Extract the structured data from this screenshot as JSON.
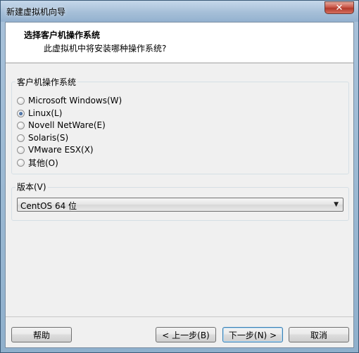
{
  "window": {
    "title": "新建虚拟机向导",
    "close_glyph": "✕"
  },
  "header": {
    "title": "选择客户机操作系统",
    "subtitle": "此虚拟机中将安装哪种操作系统?"
  },
  "os_group": {
    "label": "客户机操作系统",
    "options": [
      {
        "label": "Microsoft Windows(W)",
        "checked": false
      },
      {
        "label": "Linux(L)",
        "checked": true
      },
      {
        "label": "Novell NetWare(E)",
        "checked": false
      },
      {
        "label": "Solaris(S)",
        "checked": false
      },
      {
        "label": "VMware ESX(X)",
        "checked": false
      },
      {
        "label": "其他(O)",
        "checked": false
      }
    ]
  },
  "version_group": {
    "label": "版本(V)",
    "selected": "CentOS 64 位",
    "arrow_glyph": "▼"
  },
  "buttons": {
    "help": "帮助",
    "back": "< 上一步(B)",
    "next": "下一步(N) >",
    "cancel": "取消"
  }
}
